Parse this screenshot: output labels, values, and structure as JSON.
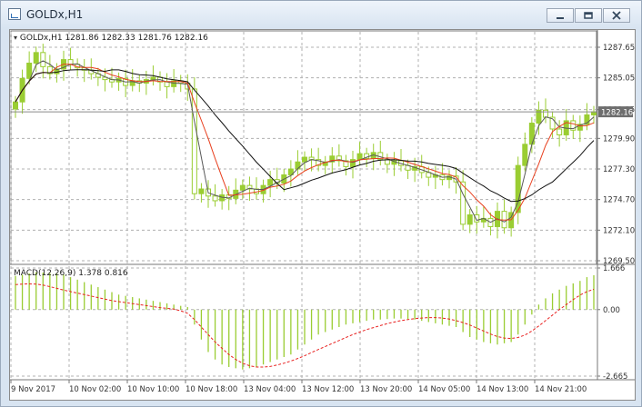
{
  "window": {
    "title": "GOLDx,H1"
  },
  "chart_info": {
    "symbol": "GOLDx,H1",
    "ohlc": "1281.86 1282.33 1281.76 1282.16"
  },
  "macd_info": {
    "label": "MACD(12,26,9)",
    "values": "1.378 0.816"
  },
  "colors": {
    "candle": "#9acd32",
    "ma_fast": "#5a5a5a",
    "ma_mid": "#e8401f",
    "ma_slow": "#111111",
    "macd_signal": "#e8201f",
    "grid": "#b0b0b0",
    "axis_bg": "#ffffff"
  },
  "chart_data": [
    {
      "type": "candlestick",
      "symbol": "GOLDx",
      "timeframe": "H1",
      "y_ticks": [
        "1287.65",
        "1285.05",
        "1282.35",
        "1279.90",
        "1277.30",
        "1274.70",
        "1272.10",
        "1269.50"
      ],
      "current_price": "1282.16",
      "ylim": [
        1269.5,
        1288.5
      ],
      "x_ticks": [
        "9 Nov 2017",
        "10 Nov 02:00",
        "10 Nov 10:00",
        "10 Nov 18:00",
        "13 Nov 04:00",
        "13 Nov 12:00",
        "13 Nov 20:00",
        "14 Nov 05:00",
        "14 Nov 13:00",
        "14 Nov 21:00"
      ],
      "close": [
        1283,
        1285,
        1286.3,
        1287.2,
        1286,
        1285.4,
        1285.8,
        1286.6,
        1286.2,
        1285.9,
        1285.7,
        1285.4,
        1285.1,
        1284.9,
        1284.7,
        1285.0,
        1284.4,
        1284.8,
        1284.6,
        1284.9,
        1285.1,
        1284.7,
        1284.3,
        1284.8,
        1284.6,
        1284.1,
        1275.2,
        1275.6,
        1275.0,
        1274.6,
        1275.1,
        1274.8,
        1275.5,
        1275.9,
        1275.6,
        1275.2,
        1275.9,
        1276.4,
        1276.1,
        1276.8,
        1277.3,
        1277.9,
        1278.3,
        1278.1,
        1277.6,
        1277.9,
        1278.4,
        1278.0,
        1277.5,
        1278.1,
        1278.6,
        1278.2,
        1278.7,
        1278.1,
        1277.7,
        1278.0,
        1277.6,
        1277.2,
        1277.5,
        1277.0,
        1276.6,
        1276.8,
        1276.4,
        1276.7,
        1276.2,
        1272.6,
        1273.4,
        1272.8,
        1273.1,
        1272.4,
        1273.7,
        1272.3,
        1273.6,
        1277.6,
        1279.4,
        1281.2,
        1282.3,
        1281.7,
        1280.7,
        1280.2,
        1281.4,
        1280.6,
        1281.1,
        1281.9,
        1282.16
      ],
      "ma_labels": []
    },
    {
      "type": "bar",
      "indicator": "MACD",
      "y_ticks": [
        "1.666",
        "0.00",
        "-2.665"
      ],
      "histogram": [
        1.35,
        1.4,
        1.45,
        1.5,
        1.48,
        1.46,
        1.44,
        1.4,
        1.3,
        1.2,
        1.1,
        1.0,
        0.9,
        0.8,
        0.7,
        0.6,
        0.55,
        0.5,
        0.45,
        0.4,
        0.35,
        0.3,
        0.25,
        0.2,
        0.15,
        0.1,
        -0.6,
        -1.2,
        -1.7,
        -2.0,
        -2.2,
        -2.3,
        -2.35,
        -2.4,
        -2.35,
        -2.3,
        -2.2,
        -2.1,
        -2.0,
        -1.9,
        -1.8,
        -1.6,
        -1.4,
        -1.2,
        -1.0,
        -0.9,
        -0.8,
        -0.7,
        -0.6,
        -0.55,
        -0.5,
        -0.45,
        -0.4,
        -0.4,
        -0.38,
        -0.36,
        -0.36,
        -0.38,
        -0.4,
        -0.45,
        -0.5,
        -0.55,
        -0.6,
        -0.65,
        -0.7,
        -0.9,
        -1.1,
        -1.2,
        -1.3,
        -1.35,
        -1.4,
        -1.35,
        -1.3,
        -1.0,
        -0.6,
        -0.2,
        0.2,
        0.45,
        0.65,
        0.8,
        0.95,
        1.05,
        1.15,
        1.3,
        1.378
      ],
      "signal": [
        1.0,
        1.02,
        1.03,
        1.02,
        0.98,
        0.92,
        0.85,
        0.78,
        0.72,
        0.66,
        0.6,
        0.54,
        0.48,
        0.42,
        0.36,
        0.32,
        0.28,
        0.24,
        0.2,
        0.16,
        0.12,
        0.08,
        0.05,
        0.02,
        -0.05,
        -0.15,
        -0.4,
        -0.7,
        -1.0,
        -1.3,
        -1.55,
        -1.8,
        -2.0,
        -2.15,
        -2.25,
        -2.3,
        -2.3,
        -2.28,
        -2.22,
        -2.15,
        -2.06,
        -1.96,
        -1.85,
        -1.72,
        -1.6,
        -1.48,
        -1.36,
        -1.24,
        -1.12,
        -1.0,
        -0.9,
        -0.8,
        -0.72,
        -0.64,
        -0.56,
        -0.5,
        -0.44,
        -0.4,
        -0.36,
        -0.34,
        -0.32,
        -0.32,
        -0.34,
        -0.38,
        -0.44,
        -0.52,
        -0.62,
        -0.74,
        -0.86,
        -0.98,
        -1.08,
        -1.14,
        -1.16,
        -1.12,
        -1.02,
        -0.86,
        -0.66,
        -0.44,
        -0.22,
        0.0,
        0.2,
        0.4,
        0.58,
        0.72,
        0.816
      ],
      "ylim": [
        -2.665,
        1.666
      ]
    }
  ]
}
